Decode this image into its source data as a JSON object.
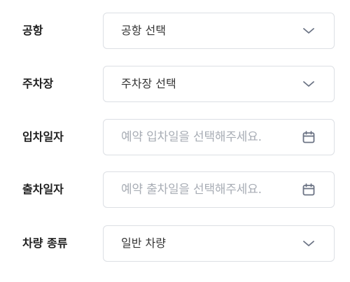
{
  "form": {
    "airport": {
      "label": "공항",
      "value": "공항 선택"
    },
    "parking": {
      "label": "주차장",
      "value": "주차장 선택"
    },
    "entry_date": {
      "label": "입차일자",
      "placeholder": "예약 입차일을 선택해주세요."
    },
    "exit_date": {
      "label": "출차일자",
      "placeholder": "예약 출차일을 선택해주세요."
    },
    "vehicle_type": {
      "label": "차량 종류",
      "value": "일반 차량"
    }
  },
  "colors": {
    "border": "#dcdfe4",
    "placeholder": "#a8adb5",
    "icon": "#6b7384",
    "label": "#1e1e1e"
  },
  "icons": {
    "select": "chevron-down-icon",
    "date": "calendar-icon"
  }
}
